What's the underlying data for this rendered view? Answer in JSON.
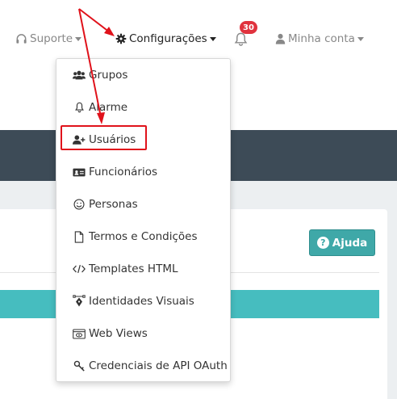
{
  "nav": {
    "support_label": "Suporte",
    "settings_label": "Configurações",
    "notifications_count": "30",
    "account_label": "Minha conta"
  },
  "menu": {
    "items": [
      {
        "label": "Grupos",
        "icon": "users-icon"
      },
      {
        "label": "Alarme",
        "icon": "bell-icon"
      },
      {
        "label": "Usuários",
        "icon": "user-plus-icon"
      },
      {
        "label": "Funcionários",
        "icon": "id-card-icon"
      },
      {
        "label": "Personas",
        "icon": "smile-icon"
      },
      {
        "label": "Termos e Condições",
        "icon": "file-icon"
      },
      {
        "label": "Templates HTML",
        "icon": "code-icon"
      },
      {
        "label": "Identidades Visuais",
        "icon": "pen-nib-icon"
      },
      {
        "label": "Web Views",
        "icon": "window-icon"
      },
      {
        "label": "Credenciais de API OAuth",
        "icon": "key-icon"
      }
    ]
  },
  "page": {
    "help_label": "Ajuda"
  },
  "colors": {
    "accent_teal": "#46bdbf",
    "header_dark": "#3d4b57",
    "badge_red": "#e0333e",
    "annotation_red": "#e0121b"
  }
}
